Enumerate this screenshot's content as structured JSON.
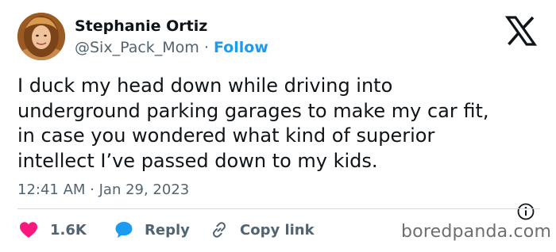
{
  "author": {
    "name": "Stephanie Ortiz",
    "handle": "@Six_Pack_Mom",
    "separator": "·",
    "follow_label": "Follow"
  },
  "tweet": {
    "lines": [
      "I duck my head down while driving into",
      "underground parking garages to make my car fit,",
      "in case you wondered what kind of superior",
      "intellect I’ve passed down to my kids."
    ],
    "timestamp": "12:41 AM · Jan 29, 2023"
  },
  "actions": {
    "likes": "1.6K",
    "reply_label": "Reply",
    "copy_label": "Copy link"
  },
  "watermark": "boredpanda.com",
  "icons": {
    "brand": "x-logo-icon",
    "info": "info-icon",
    "like": "heart-icon",
    "reply": "speech-bubble-icon",
    "copy": "link-icon"
  },
  "colors": {
    "text": "#0f1419",
    "secondary": "#536471",
    "accent": "#1d9bf0",
    "heart": "#f91880"
  }
}
